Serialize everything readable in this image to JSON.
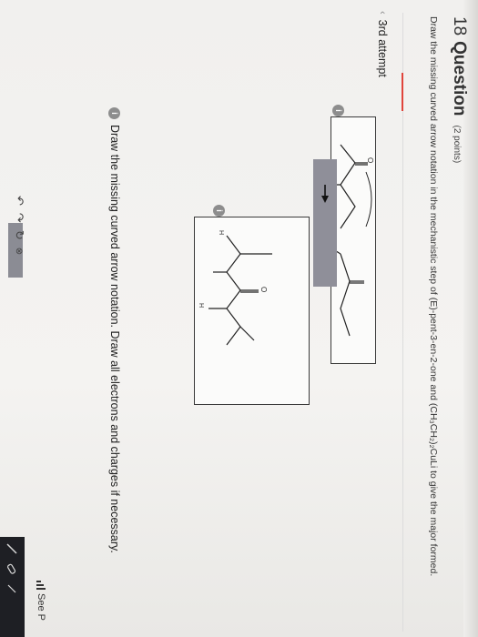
{
  "question": {
    "number": "18",
    "label": "Question",
    "points": "(2 points)",
    "text": "Draw the missing curved arrow notation in the mechanistic step of (E)-pent-3-en-2-one and (CH₃CH₂)₂CuLi to give the major formed."
  },
  "attempt": {
    "chevron": "‹",
    "label": "3rd attempt"
  },
  "prompt": {
    "text": "Draw the missing curved arrow notation. Draw all electrons and charges if necessary."
  },
  "info_icon": "i",
  "molecule_labels": {
    "oxygen": "O",
    "h": "H",
    "h_left": "H",
    "h_right": "H"
  },
  "see_periodic": {
    "icon": "bar-chart-icon",
    "text": "See P"
  },
  "toolbar": {
    "undo": "↶",
    "redo": "↷",
    "reset": "↻",
    "zoom": "⊗"
  }
}
